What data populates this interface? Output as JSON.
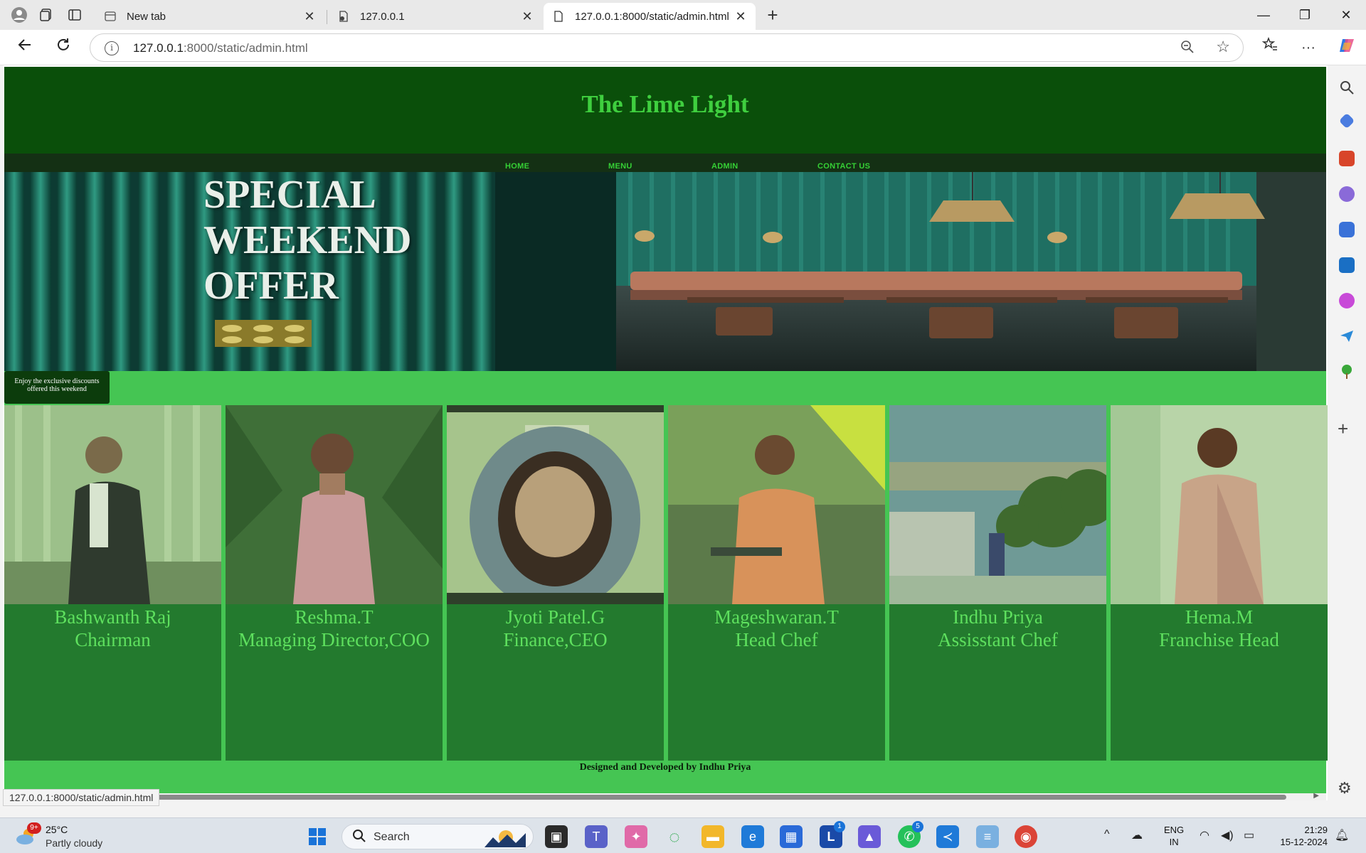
{
  "browser": {
    "tabs": [
      {
        "title": "New tab",
        "active": false
      },
      {
        "title": "127.0.0.1",
        "active": false
      },
      {
        "title": "127.0.0.1:8000/static/admin.html",
        "active": true
      }
    ],
    "url_host": "127.0.0.1",
    "url_rest": ":8000/static/admin.html",
    "status_url": "127.0.0.1:8000/static/admin.html"
  },
  "site": {
    "title": "The Lime Light",
    "nav": [
      "HOME",
      "MENU",
      "ADMIN",
      "CONTACT US"
    ],
    "hero_lines": [
      "SPECIAL",
      "WEEKEND",
      "OFFER"
    ],
    "tooltip": "Enjoy the exclusive discounts offered this weekend",
    "team": [
      {
        "name": "Bashwanth Raj",
        "role": "Chairman"
      },
      {
        "name": "Reshma.T",
        "role": "Managing Director,COO"
      },
      {
        "name": "Jyoti Patel.G",
        "role": "Finance,CEO"
      },
      {
        "name": "Mageshwaran.T",
        "role": "Head Chef"
      },
      {
        "name": "Indhu Priya",
        "role": "Assisstant Chef"
      },
      {
        "name": "Hema.M",
        "role": "Franchise Head"
      }
    ],
    "footer": "Designed and Developed by Indhu Priya"
  },
  "taskbar": {
    "weather_badge": "9+",
    "temperature": "25°C",
    "condition": "Partly cloudy",
    "search_label": "Search",
    "lang_top": "ENG",
    "lang_bottom": "IN",
    "time": "21:29",
    "date": "15-12-2024",
    "badge_l": "1",
    "badge_whatsapp": "5"
  },
  "colors": {
    "header": "#0a4f0a",
    "title": "#3fcf3f",
    "band": "#45c553",
    "card": "#237a2e"
  }
}
